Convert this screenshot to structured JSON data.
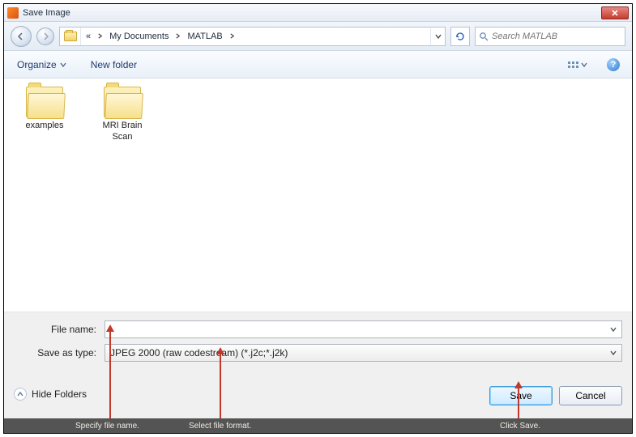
{
  "window": {
    "title": "Save Image"
  },
  "breadcrumb": {
    "prefix": "«",
    "parts": [
      "My Documents",
      "MATLAB"
    ]
  },
  "search": {
    "placeholder": "Search MATLAB"
  },
  "toolbar": {
    "organize": "Organize",
    "newfolder": "New folder"
  },
  "files": [
    {
      "label": "examples"
    },
    {
      "label": "MRI Brain\nScan"
    }
  ],
  "form": {
    "filename_label": "File name:",
    "filename_value": "",
    "saveastype_label": "Save as type:",
    "saveastype_value": "JPEG 2000 (raw codestream) (*.j2c;*.j2k)"
  },
  "buttons": {
    "hidefolders": "Hide Folders",
    "save": "Save",
    "cancel": "Cancel"
  },
  "annotations": {
    "a1": "Specify file name.",
    "a2": "Select file format.",
    "a3": "Click Save."
  }
}
